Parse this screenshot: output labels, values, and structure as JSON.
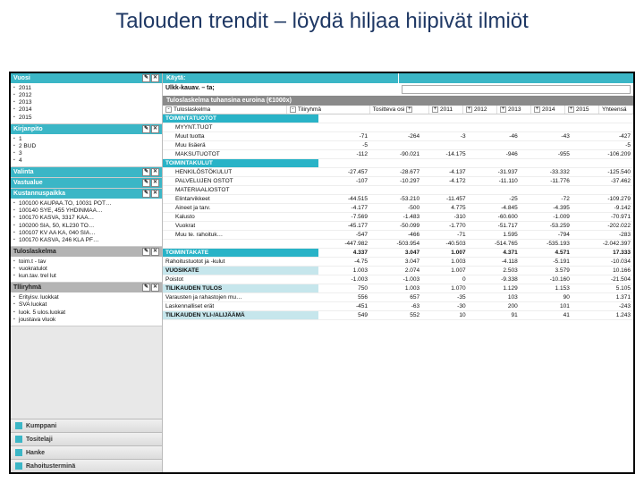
{
  "title": "Talouden trendit – löydä hiljaa hiipivät ilmiöt",
  "left": {
    "panels": [
      {
        "title": "Vuosi",
        "style": "cyan",
        "items": [
          "2011",
          "2012",
          "2013",
          "2014",
          "2015"
        ]
      },
      {
        "title": "Kirjanpito",
        "style": "cyan",
        "items": [
          "1",
          "2 BUD",
          "3",
          "4"
        ]
      },
      {
        "title": "Valinta",
        "style": "cyan",
        "items": []
      },
      {
        "title": "Vastualue",
        "style": "cyan",
        "items": []
      },
      {
        "title": "Kustannuspaikka",
        "style": "cyan",
        "items": [
          "100100 KAUPAA.TO, 10031 POT…",
          "100140 SYE, 455 YHDINMAA…",
          "100170 KASVA, 3317 KAA…",
          "100200 SIA, 50, KL230 TO…",
          "100107 KV AA KA, 040 SIA…",
          "100170 KASVA, 246 KLA PF…"
        ]
      },
      {
        "title": "Tuloslaskelma",
        "style": "gray",
        "items": [
          "toim.t - tav",
          "vuokratulot",
          "kun.tav. trel lut"
        ]
      },
      {
        "title": "Tlliryhmä",
        "style": "gray",
        "items": [
          "Erityisv. luokkat",
          "SVA luokat",
          "luok. 5 ulos.luokat",
          "joustava vluok"
        ]
      }
    ],
    "accordion": [
      "Kumppani",
      "Tositelaji",
      "Hanke",
      "Rahoitusterminä"
    ]
  },
  "top": {
    "search_label": "Käytä:",
    "search_value": "Ulkk-kauav. – ta;",
    "grid_title": "Tuloslaskelma tuhansina euroina (€1000x)"
  },
  "pivot_headers": {
    "c1": "Tuloslaskelma",
    "c2": "Tiliryhmä",
    "c3": "Tositteva osi",
    "years": [
      "2011",
      "2012",
      "2013",
      "2014",
      "2015"
    ],
    "total": "Yhteensä"
  },
  "rows": [
    {
      "label": "TOIMINTATUOTOT",
      "cls": "row-lbl-cyan",
      "span": true
    },
    {
      "label": "MYYNT.TUOT",
      "indent": 1,
      "v": [
        "",
        "",
        "",
        "",
        "",
        ""
      ]
    },
    {
      "label": "Muut tuotta",
      "indent": 2,
      "v": [
        "-71",
        "-264",
        "-3",
        "-46",
        "-43",
        "-427"
      ]
    },
    {
      "label": "Muu lisäerä",
      "indent": 2,
      "v": [
        "-5",
        "",
        "",
        "",
        "",
        "-5"
      ]
    },
    {
      "label": "MAKSUTUOTOT",
      "indent": 1,
      "v": [
        "-112",
        "-90.021",
        "-14.175",
        "-946",
        "-955",
        "-106.209"
      ]
    },
    {
      "label": "TOIMINTAKULUT",
      "cls": "row-lbl-cyan",
      "span": true
    },
    {
      "label": "HENKILÖSTÖKULUT",
      "indent": 1,
      "v": [
        "-27.457",
        "-28.677",
        "-4.137",
        "-31.937",
        "-33.332",
        "-125.540"
      ]
    },
    {
      "label": "PALVELUJEN OSTOT",
      "indent": 1,
      "v": [
        "-107",
        "-10.297",
        "-4.172",
        "-11.110",
        "-11.776",
        "-37.462"
      ]
    },
    {
      "label": "MATERIAALIOSTOT",
      "indent": 1,
      "v": [
        "",
        "",
        "",
        "",
        "",
        ""
      ]
    },
    {
      "label": "Elintarvikkeet",
      "indent": 2,
      "v": [
        "-44.515",
        "-53.210",
        "-11.457",
        "-25",
        "-72",
        "-109.279"
      ]
    },
    {
      "label": "Aineet ja tarv.",
      "indent": 2,
      "v": [
        "-4.177",
        "-500",
        "4.775",
        "-4.845",
        "-4.395",
        "-9.142"
      ]
    },
    {
      "label": "Kalusto",
      "indent": 2,
      "v": [
        "-7.569",
        "-1.483",
        "-310",
        "-60.600",
        "-1.009",
        "-70.971"
      ]
    },
    {
      "label": "Vuokrat",
      "indent": 2,
      "v": [
        "-45.177",
        "-50.099",
        "-1.770",
        "-51.717",
        "-53.259",
        "-202.022"
      ]
    },
    {
      "label": "Muu te. rahoituk…",
      "indent": 2,
      "v": [
        "-547",
        "-466",
        "-71",
        "1.595",
        "-794",
        "-283"
      ]
    },
    {
      "label": "",
      "indent": 2,
      "v": [
        "-447.982",
        "-503.954",
        "-40.503",
        "-514.765",
        "-535.193",
        "-2.042.397"
      ]
    },
    {
      "label": "TOIMINTAKATE",
      "cls": "row-lbl-cyan",
      "v": [
        "4.337",
        "3.047",
        "1.007",
        "4.371",
        "4.571",
        "17.333"
      ]
    },
    {
      "label": "Rahoitustuotot ja -kulut",
      "v": [
        "-4.75",
        "3.047",
        "1.003",
        "-4.118",
        "-5.191",
        "-10.034"
      ]
    },
    {
      "label": "VUOSIKATE",
      "cls": "row-lbl-sel",
      "v": [
        "1.003",
        "2.074",
        "1.007",
        "2.503",
        "3.579",
        "10.166"
      ]
    },
    {
      "label": "Poistot",
      "v": [
        "-1.003",
        "-1.003",
        "0",
        "-9.338",
        "-10.160",
        "-21.504"
      ]
    },
    {
      "label": "TILIKAUDEN TULOS",
      "cls": "row-lbl-sel",
      "v": [
        "750",
        "1.003",
        "1.070",
        "1.129",
        "1.153",
        "5.105"
      ]
    },
    {
      "label": "Varausten ja rahastojen mu…",
      "v": [
        "556",
        "657",
        "-35",
        "103",
        "90",
        "1.371"
      ]
    },
    {
      "label": "Laskennalliset erät",
      "v": [
        "-451",
        "-63",
        "-30",
        "200",
        "101",
        "-243"
      ]
    },
    {
      "label": "TILIKAUDEN YLI-/ALIJÄÄMÄ",
      "cls": "row-lbl-sel",
      "v": [
        "549",
        "552",
        "10",
        "91",
        "41",
        "1.243"
      ]
    }
  ]
}
